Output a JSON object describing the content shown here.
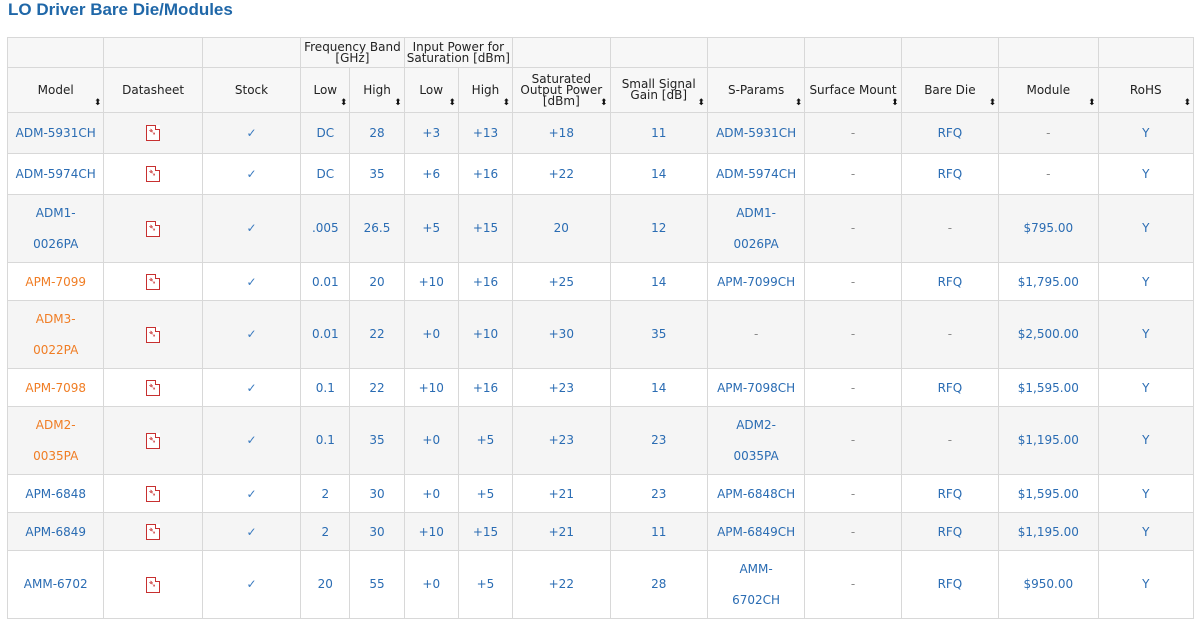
{
  "page": {
    "title": "LO Driver Bare Die/Modules"
  },
  "table": {
    "group_headers": {
      "frequency_band": "Frequency Band [GHz]",
      "input_power": "Input Power for Saturation [dBm]"
    },
    "columns": [
      "Model",
      "Datasheet",
      "Stock",
      "Low",
      "High",
      "Low",
      "High",
      "Saturated Output Power [dBm]",
      "Small Signal Gain [dB]",
      "S-Params",
      "Surface Mount",
      "Bare Die",
      "Module",
      "RoHS"
    ],
    "sort_icon": "sort-arrows-icon",
    "rows": [
      {
        "model": "ADM-5931CH",
        "stock": "✓",
        "f_low": "DC",
        "f_high": "28",
        "p_low": "+3",
        "p_high": "+13",
        "sat": "+18",
        "gain": "11",
        "sparams": "ADM-5931CH",
        "smt": "-",
        "bare": "RFQ",
        "module": "-",
        "rohs": "Y",
        "color": "blue"
      },
      {
        "model": "ADM-5974CH",
        "stock": "✓",
        "f_low": "DC",
        "f_high": "35",
        "p_low": "+6",
        "p_high": "+16",
        "sat": "+22",
        "gain": "14",
        "sparams": "ADM-5974CH",
        "smt": "-",
        "bare": "RFQ",
        "module": "-",
        "rohs": "Y",
        "color": "blue"
      },
      {
        "model": "ADM1-0026PA",
        "model_a": "ADM1-",
        "model_b": "0026PA",
        "stock": "✓",
        "f_low": ".005",
        "f_high": "26.5",
        "p_low": "+5",
        "p_high": "+15",
        "sat": "20",
        "gain": "12",
        "sparams": "ADM1-0026PA",
        "sp_a": "ADM1-",
        "sp_b": "0026PA",
        "smt": "-",
        "bare": "-",
        "module": "$795.00",
        "rohs": "Y",
        "color": "blue"
      },
      {
        "model": "APM-7099",
        "stock": "✓",
        "f_low": "0.01",
        "f_high": "20",
        "p_low": "+10",
        "p_high": "+16",
        "sat": "+25",
        "gain": "14",
        "sparams": "APM-7099CH",
        "smt": "-",
        "bare": "RFQ",
        "module": "$1,795.00",
        "rohs": "Y",
        "color": "orange"
      },
      {
        "model": "ADM3-0022PA",
        "model_a": "ADM3-",
        "model_b": "0022PA",
        "stock": "✓",
        "f_low": "0.01",
        "f_high": "22",
        "p_low": "+0",
        "p_high": "+10",
        "sat": "+30",
        "gain": "35",
        "sparams": "-",
        "smt": "-",
        "bare": "-",
        "module": "$2,500.00",
        "rohs": "Y",
        "color": "orange"
      },
      {
        "model": "APM-7098",
        "stock": "✓",
        "f_low": "0.1",
        "f_high": "22",
        "p_low": "+10",
        "p_high": "+16",
        "sat": "+23",
        "gain": "14",
        "sparams": "APM-7098CH",
        "smt": "-",
        "bare": "RFQ",
        "module": "$1,595.00",
        "rohs": "Y",
        "color": "orange"
      },
      {
        "model": "ADM2-0035PA",
        "model_a": "ADM2-",
        "model_b": "0035PA",
        "stock": "✓",
        "f_low": "0.1",
        "f_high": "35",
        "p_low": "+0",
        "p_high": "+5",
        "sat": "+23",
        "gain": "23",
        "sparams": "ADM2-0035PA",
        "sp_a": "ADM2-",
        "sp_b": "0035PA",
        "smt": "-",
        "bare": "-",
        "module": "$1,195.00",
        "rohs": "Y",
        "color": "orange"
      },
      {
        "model": "APM-6848",
        "stock": "✓",
        "f_low": "2",
        "f_high": "30",
        "p_low": "+0",
        "p_high": "+5",
        "sat": "+21",
        "gain": "23",
        "sparams": "APM-6848CH",
        "smt": "-",
        "bare": "RFQ",
        "module": "$1,595.00",
        "rohs": "Y",
        "color": "blue"
      },
      {
        "model": "APM-6849",
        "stock": "✓",
        "f_low": "2",
        "f_high": "30",
        "p_low": "+10",
        "p_high": "+15",
        "sat": "+21",
        "gain": "11",
        "sparams": "APM-6849CH",
        "smt": "-",
        "bare": "RFQ",
        "module": "$1,195.00",
        "rohs": "Y",
        "color": "blue"
      },
      {
        "model": "AMM-6702",
        "stock": "✓",
        "f_low": "20",
        "f_high": "55",
        "p_low": "+0",
        "p_high": "+5",
        "sat": "+22",
        "gain": "28",
        "sparams": "AMM-6702CH",
        "sp_a": "AMM-",
        "sp_b": "6702CH",
        "smt": "-",
        "bare": "RFQ",
        "module": "$950.00",
        "rohs": "Y",
        "color": "blue"
      }
    ]
  },
  "colors": {
    "link_blue": "#2a6cb3",
    "link_orange": "#f07d24",
    "title_blue": "#1f67a8"
  }
}
